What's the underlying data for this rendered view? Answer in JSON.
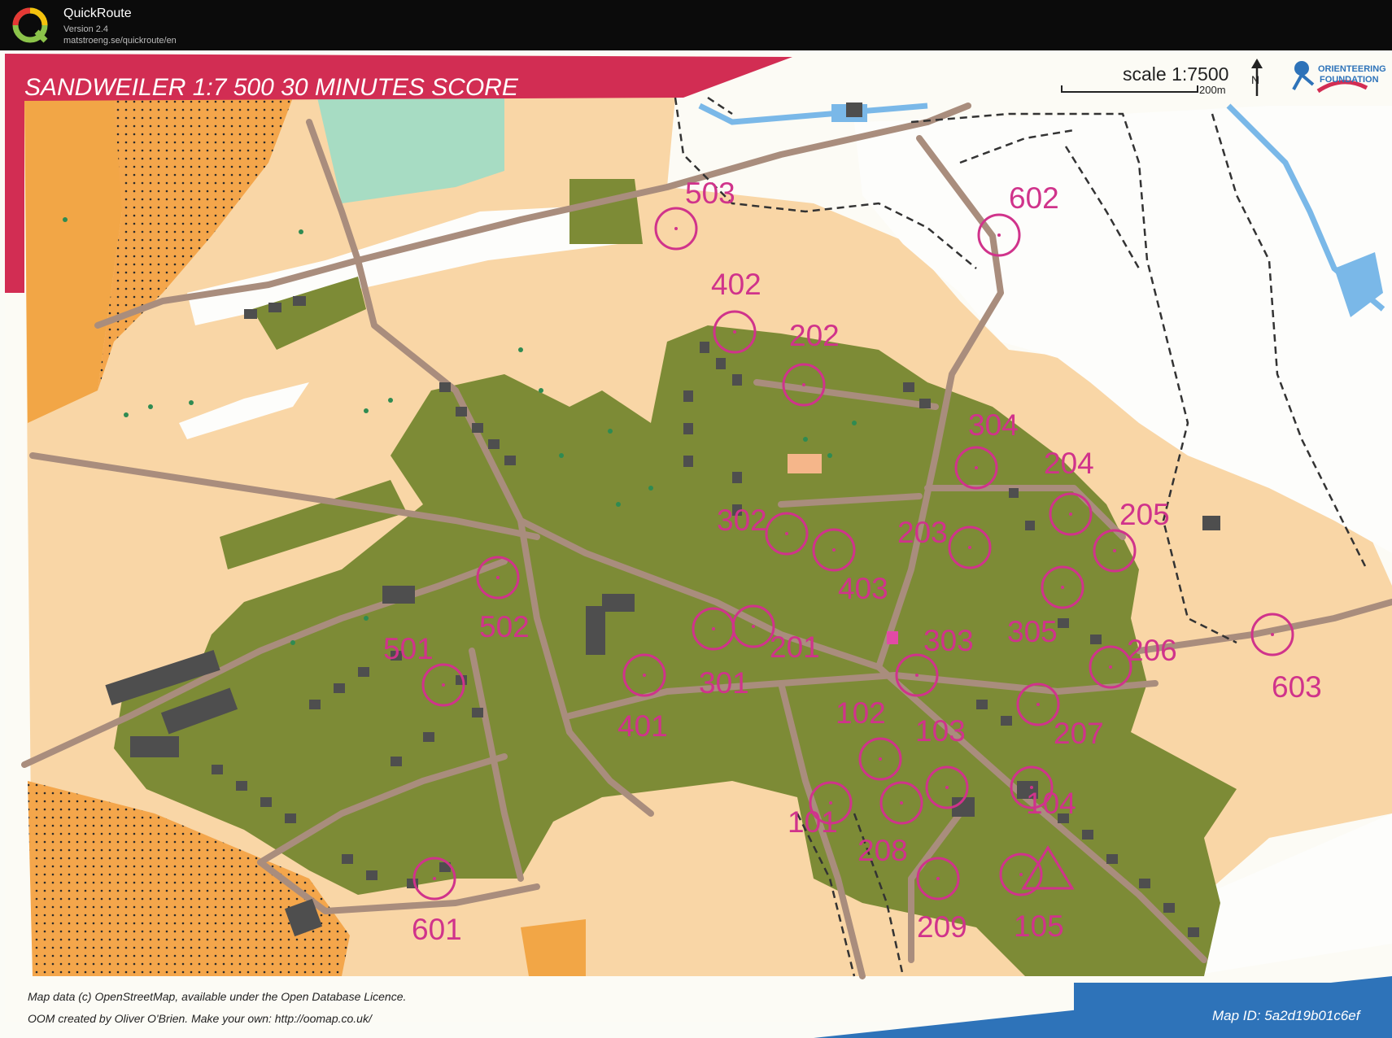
{
  "app": {
    "name": "QuickRoute",
    "version": "Version 2.4",
    "url": "matstroeng.se/quickroute/en"
  },
  "map": {
    "title": "SANDWEILER 1:7 500   30 MINUTES SCORE",
    "scale_text": "scale 1:7500",
    "scale_bar_label": "200m",
    "north_label": "N",
    "logo_text": [
      "ORIENTEERING",
      "FOUNDATION"
    ],
    "footer": {
      "line1": "Map data (c) OpenStreetMap, available under the Open Database Licence.",
      "line2": "OOM created by Oliver O'Brien. Make your own: http://oomap.co.uk/",
      "map_id": "Map ID: 5a2d19b01c6ef"
    },
    "colors": {
      "control": "#d0338b",
      "open_land": "#f9d6a6",
      "rough_open": "#f2a646",
      "settlement": "#7d8b36",
      "building": "#4e4e4e",
      "road": "#a98d7d",
      "water": "#7ab8e8",
      "green_area": "#a7dcc3",
      "title_band": "#d22d53",
      "footer_band": "#2e73b9"
    },
    "controls": [
      {
        "number": "101"
      },
      {
        "number": "102"
      },
      {
        "number": "103"
      },
      {
        "number": "104"
      },
      {
        "number": "105"
      },
      {
        "number": "201"
      },
      {
        "number": "202"
      },
      {
        "number": "203"
      },
      {
        "number": "204"
      },
      {
        "number": "205"
      },
      {
        "number": "206"
      },
      {
        "number": "207"
      },
      {
        "number": "208"
      },
      {
        "number": "209"
      },
      {
        "number": "301"
      },
      {
        "number": "302"
      },
      {
        "number": "303"
      },
      {
        "number": "304"
      },
      {
        "number": "305"
      },
      {
        "number": "401"
      },
      {
        "number": "402"
      },
      {
        "number": "403"
      },
      {
        "number": "501"
      },
      {
        "number": "502"
      },
      {
        "number": "503"
      },
      {
        "number": "601"
      },
      {
        "number": "602"
      },
      {
        "number": "603"
      }
    ]
  }
}
